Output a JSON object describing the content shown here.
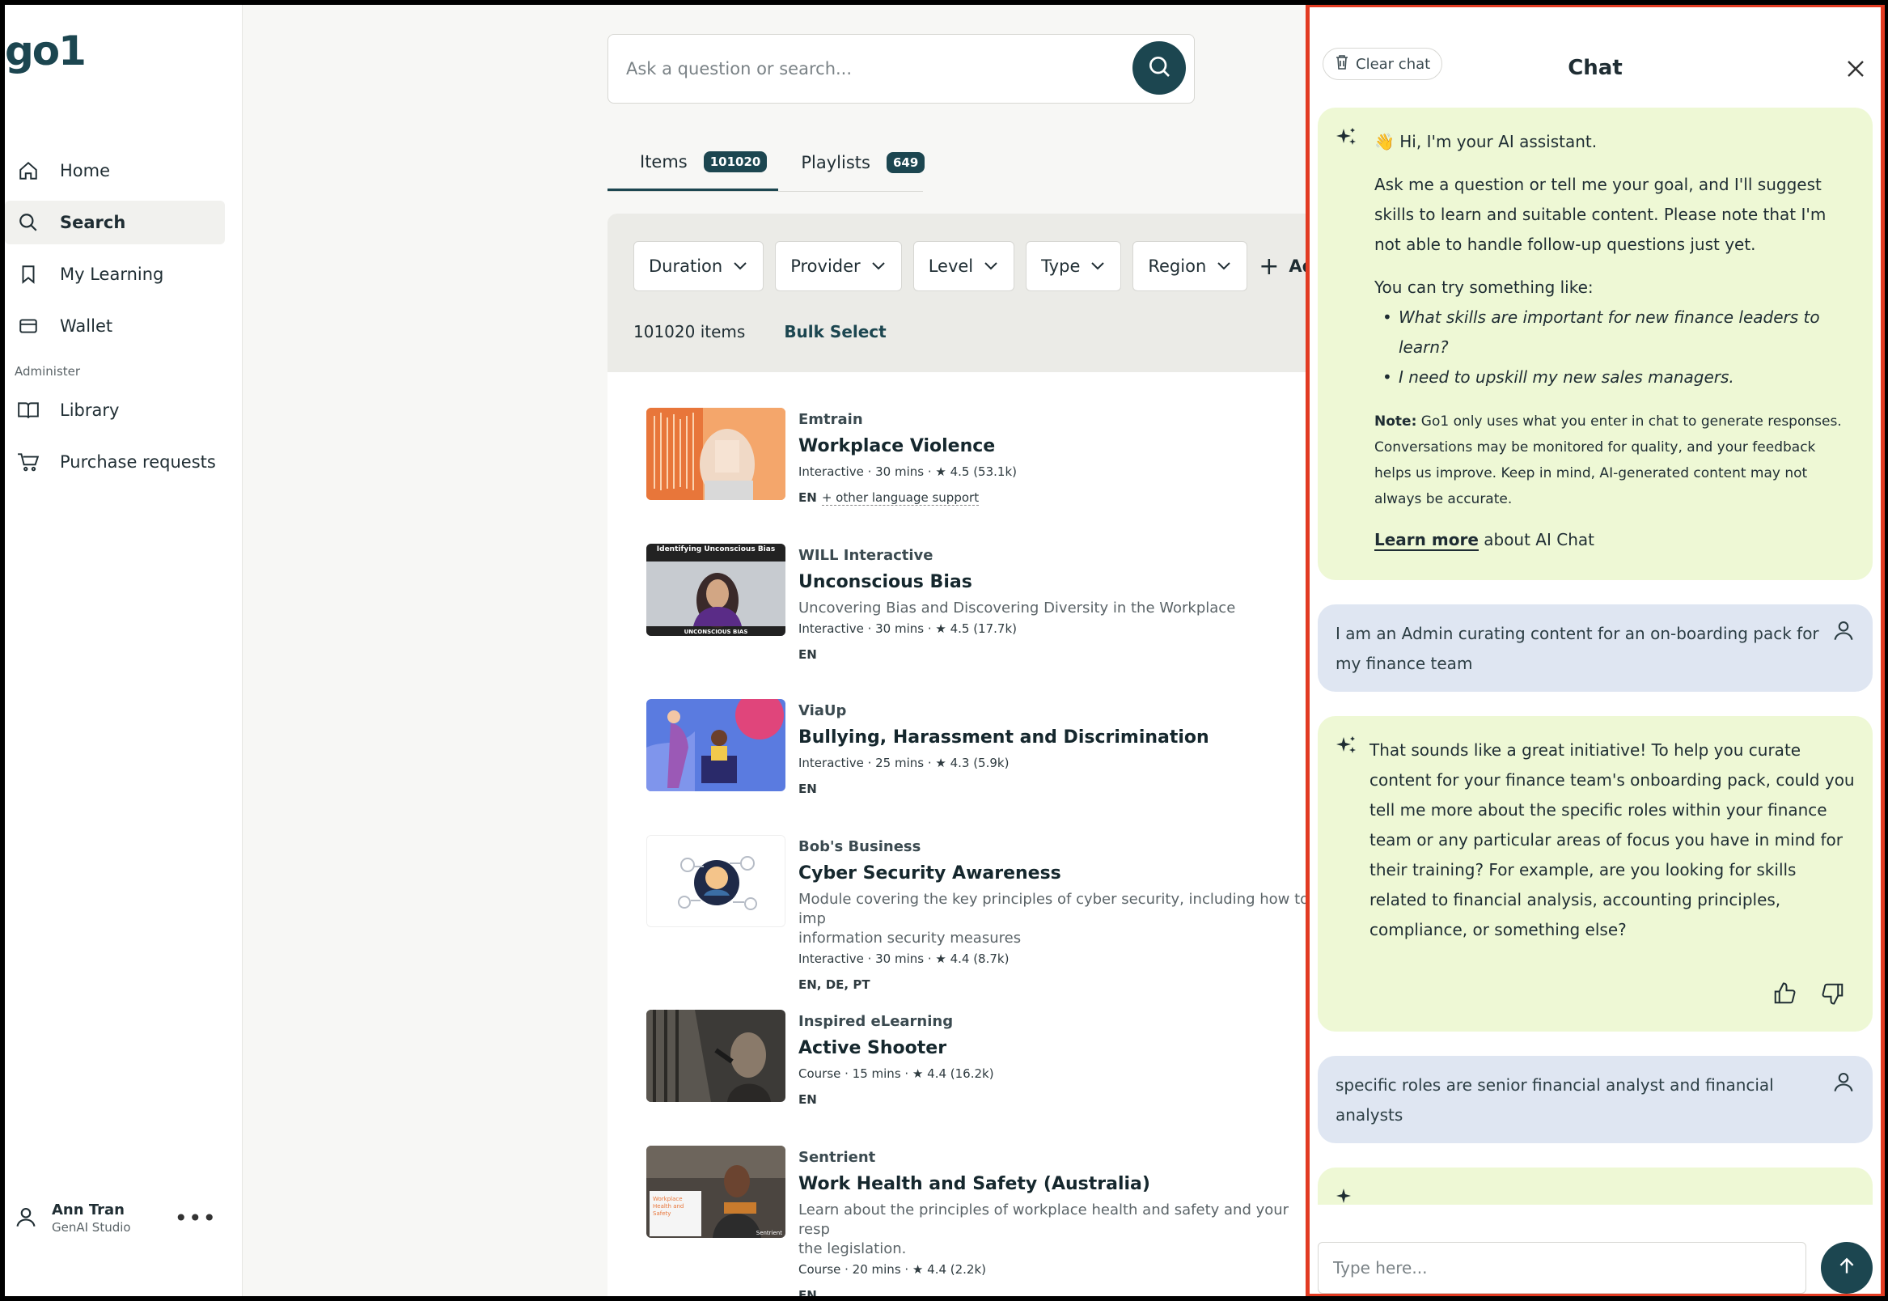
{
  "sidebar": {
    "logo": "go1",
    "nav": [
      {
        "label": "Home",
        "icon": "home-icon"
      },
      {
        "label": "Search",
        "icon": "search-icon"
      },
      {
        "label": "My Learning",
        "icon": "bookmark-icon"
      },
      {
        "label": "Wallet",
        "icon": "wallet-icon"
      }
    ],
    "admin_section": "Administer",
    "admin_nav": [
      {
        "label": "Library",
        "icon": "book-icon"
      },
      {
        "label": "Purchase requests",
        "icon": "cart-icon"
      }
    ],
    "user": {
      "name": "Ann Tran",
      "org": "GenAI Studio",
      "more": "•••"
    }
  },
  "search": {
    "placeholder": "Ask a question or search..."
  },
  "tabs": [
    {
      "label": "Items",
      "count": "101020"
    },
    {
      "label": "Playlists",
      "count": "649"
    }
  ],
  "filters": [
    "Duration",
    "Provider",
    "Level",
    "Type",
    "Region"
  ],
  "add_filter": "Ad",
  "results_count": "101020 items",
  "bulk_select": "Bulk Select",
  "results": [
    {
      "provider": "Emtrain",
      "title": "Workplace Violence",
      "desc": "",
      "stats": "Interactive · 30 mins · ★ 4.5 (53.1k)",
      "langs": "EN",
      "extra_langs": "+ other language support"
    },
    {
      "provider": "WILL Interactive",
      "title": "Unconscious Bias",
      "desc": "Uncovering Bias and Discovering Diversity in the Workplace",
      "stats": "Interactive · 30 mins · ★ 4.5 (17.7k)",
      "langs": "EN",
      "extra_langs": "",
      "thumb_text": "Identifying Unconscious Bias",
      "thumb_footer": "UNCONSCIOUS BIAS"
    },
    {
      "provider": "ViaUp",
      "title": "Bullying, Harassment and Discrimination",
      "desc": "",
      "stats": "Interactive · 25 mins · ★ 4.3 (5.9k)",
      "langs": "EN",
      "extra_langs": ""
    },
    {
      "provider": "Bob's Business",
      "title": "Cyber Security Awareness",
      "desc": "Module covering the key principles of cyber security, including how to imp\ninformation security measures",
      "stats": "Interactive · 30 mins · ★ 4.4 (8.7k)",
      "langs": "EN, DE, PT",
      "extra_langs": ""
    },
    {
      "provider": "Inspired eLearning",
      "title": "Active Shooter",
      "desc": "",
      "stats": "Course · 15 mins · ★ 4.4 (16.2k)",
      "langs": "EN",
      "extra_langs": ""
    },
    {
      "provider": "Sentrient",
      "title": "Work Health and Safety (Australia)",
      "desc": "Learn about the principles of workplace health and safety and your resp\nthe legislation.",
      "stats": "Course · 20 mins · ★ 4.4 (2.2k)",
      "langs": "EN",
      "extra_langs": "",
      "thumb_text": "Workplace Health and Safety",
      "thumb_footer": "Sentrient"
    }
  ],
  "chat": {
    "clear_label": "Clear chat",
    "title": "Chat",
    "greeting": "👋 Hi, I'm your AI assistant.",
    "intro": "Ask me a question or tell me your goal, and I'll suggest skills to learn and suitable content. Please note that I'm not able to handle follow-up questions just yet.",
    "try_label": "You can try something like:",
    "examples": [
      "What skills are important for new finance leaders to learn?",
      "I need to upskill my new sales managers."
    ],
    "note_label": "Note:",
    "note_text": " Go1 only uses what you enter in chat to generate responses. Conversations may be monitored for quality, and your feedback helps us improve. Keep in mind, AI-generated content may not always be accurate.",
    "learn_more": "Learn more",
    "learn_more_suffix": " about AI Chat",
    "user_msg_1": "I am an Admin curating content for an on-boarding pack for my finance team",
    "ai_msg_1": "That sounds like a great initiative! To help you curate content for your finance team's onboarding pack, could you tell me more about the specific roles within your finance team or any particular areas of focus you have in mind for their training? For example, are you looking for skills related to financial analysis, accounting principles, compliance, or something else?",
    "user_msg_2": "specific roles are senior financial analyst and financial analysts",
    "input_placeholder": "Type here..."
  },
  "colors": {
    "brand": "#1c4650",
    "ai_bubble": "#eef8d5",
    "user_bubble": "#dfe6f2",
    "highlight_border": "#e23b22"
  }
}
